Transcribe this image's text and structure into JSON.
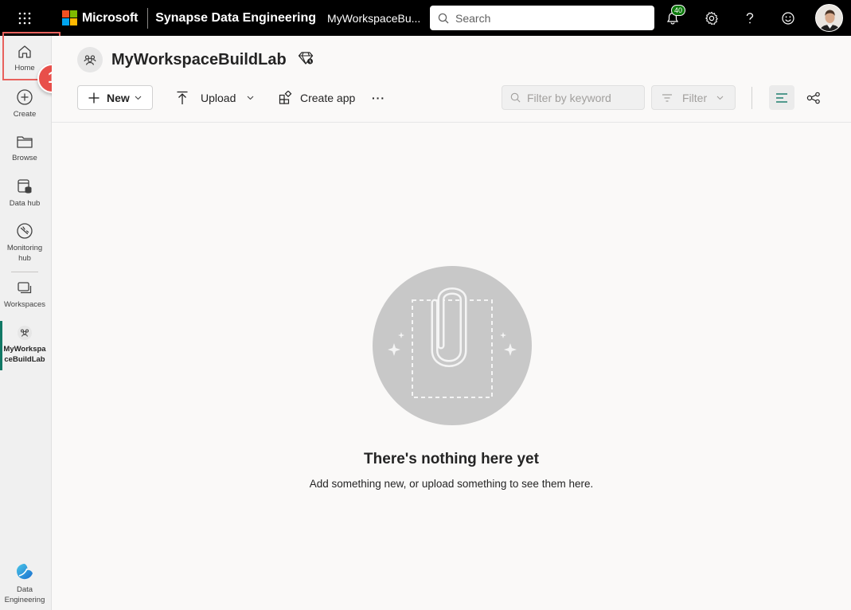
{
  "topbar": {
    "brand": "Microsoft",
    "app_name": "Synapse Data Engineering",
    "workspace_crumb": "MyWorkspaceBu...",
    "search_placeholder": "Search",
    "notification_count": "40"
  },
  "nav": {
    "items": [
      {
        "label": "Home",
        "icon": "home-icon"
      },
      {
        "label": "Create",
        "icon": "plus-circle-icon"
      },
      {
        "label": "Browse",
        "icon": "folder-icon"
      },
      {
        "label": "Data hub",
        "icon": "data-hub-icon"
      },
      {
        "label": "Monitoring hub",
        "icon": "monitoring-icon"
      },
      {
        "label": "Workspaces",
        "icon": "workspaces-icon"
      },
      {
        "label": "MyWorkspaceBuildLab",
        "icon": "workspace-people-icon"
      },
      {
        "label": "Data Engineering",
        "icon": "data-engineering-logo"
      }
    ],
    "callout_number": "1"
  },
  "workspace": {
    "title": "MyWorkspaceBuildLab"
  },
  "toolbar": {
    "new_label": "New",
    "upload_label": "Upload",
    "create_app_label": "Create app",
    "more_label": "···",
    "filter_placeholder": "Filter by keyword",
    "filter_label": "Filter"
  },
  "empty_state": {
    "title": "There's nothing here yet",
    "subtitle": "Add something new, or upload something to see them here."
  },
  "colors": {
    "accent": "#117865",
    "callout": "#e84f4a",
    "notification_badge": "#0e7a0d"
  }
}
